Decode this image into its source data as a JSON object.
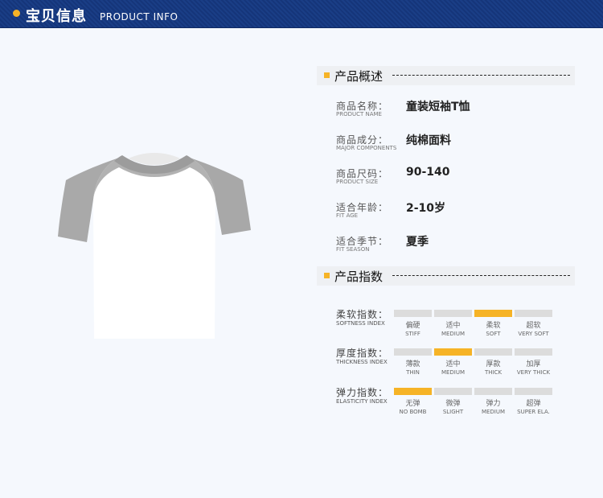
{
  "header": {
    "title_cn": "宝贝信息",
    "title_en": "PRODUCT INFO"
  },
  "overview": {
    "title": "产品概述",
    "rows": [
      {
        "cn": "商品名称：",
        "en": "PRODUCT NAME",
        "value": "童装短袖T恤"
      },
      {
        "cn": "商品成分：",
        "en": "MAJOR COMPONENTS",
        "value": "纯棉面料"
      },
      {
        "cn": "商品尺码：",
        "en": "PRODUCT SIZE",
        "value": "90-140"
      },
      {
        "cn": "适合年龄：",
        "en": "FIT AGE",
        "value": "2-10岁"
      },
      {
        "cn": "适合季节：",
        "en": "FIT SEASON",
        "value": "夏季"
      }
    ]
  },
  "indices": {
    "title": "产品指数",
    "rows": [
      {
        "cn": "柔软指数：",
        "en": "SOFTNESS INDEX",
        "selected": 2,
        "options": [
          {
            "cn": "偏硬",
            "en": "STIFF"
          },
          {
            "cn": "适中",
            "en": "MEDIUM"
          },
          {
            "cn": "柔软",
            "en": "SOFT"
          },
          {
            "cn": "超软",
            "en": "VERY SOFT"
          }
        ]
      },
      {
        "cn": "厚度指数：",
        "en": "THICKNESS INDEX",
        "selected": 1,
        "options": [
          {
            "cn": "薄款",
            "en": "THIN"
          },
          {
            "cn": "适中",
            "en": "MEDIUM"
          },
          {
            "cn": "厚款",
            "en": "THICK"
          },
          {
            "cn": "加厚",
            "en": "VERY THICK"
          }
        ]
      },
      {
        "cn": "弹力指数：",
        "en": "ELASTICITY INDEX",
        "selected": 0,
        "options": [
          {
            "cn": "无弹",
            "en": "NO BOMB"
          },
          {
            "cn": "微弹",
            "en": "SLIGHT"
          },
          {
            "cn": "弹力",
            "en": "MEDIUM"
          },
          {
            "cn": "超弹",
            "en": "SUPER ELA."
          }
        ]
      }
    ]
  },
  "colors": {
    "accent": "#f6b326",
    "header_bg": "#1a3e86",
    "inactive_bar": "#dcdcdc",
    "sleeve": "#a9a9a9"
  }
}
